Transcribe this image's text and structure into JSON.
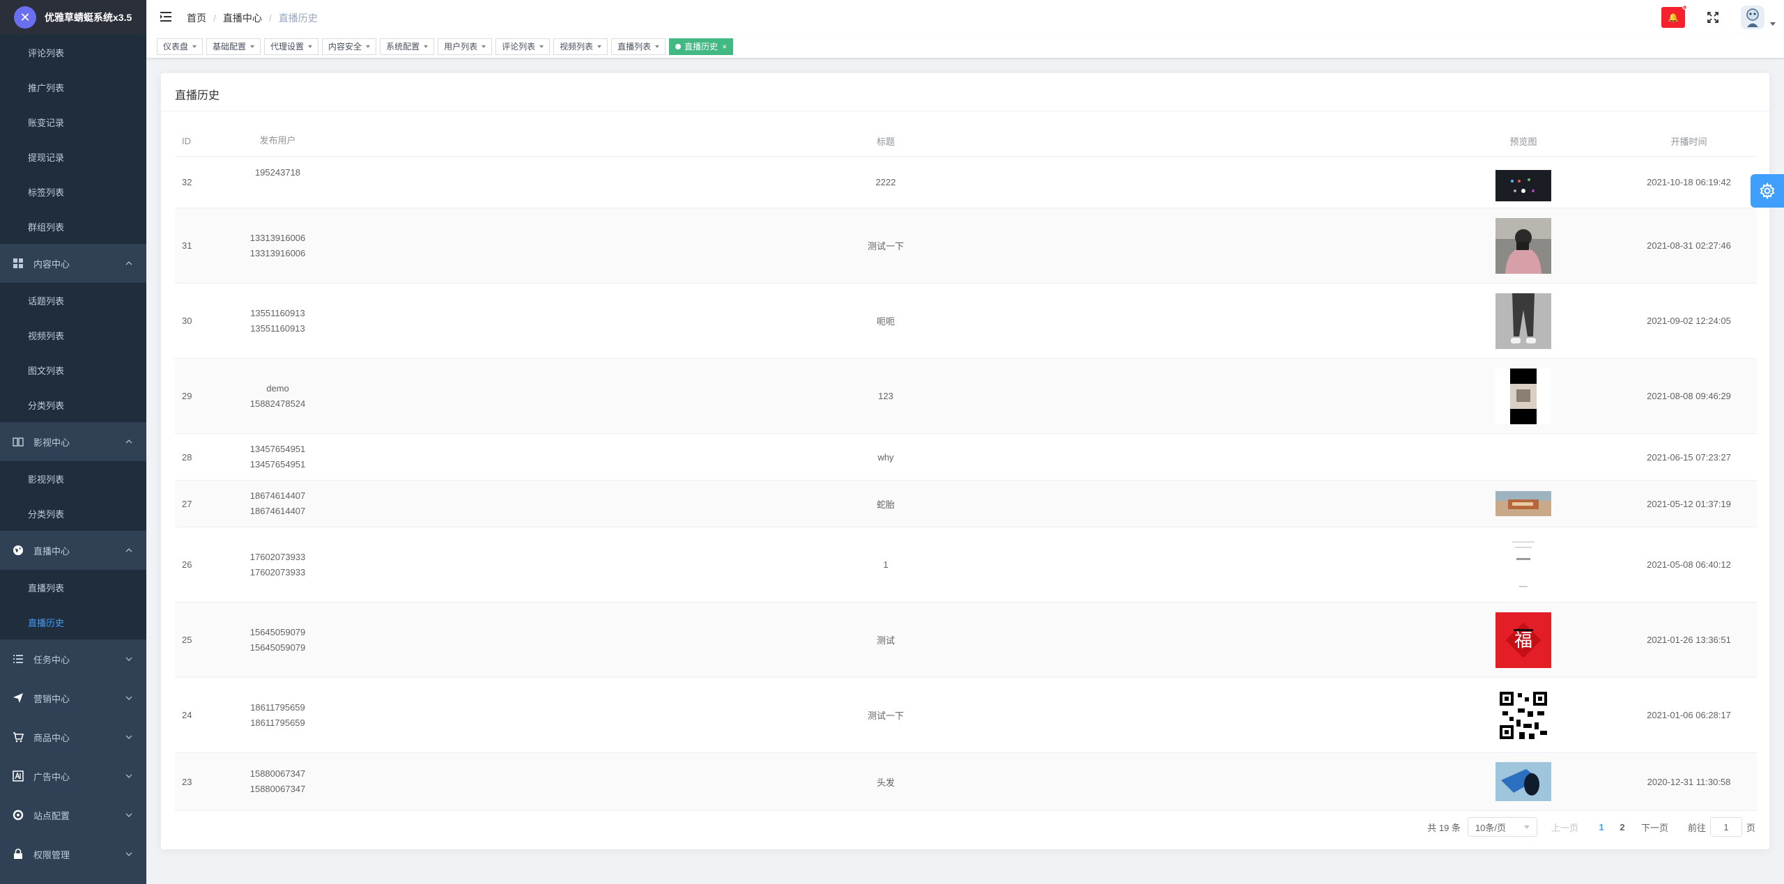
{
  "app": {
    "title": "优雅草蜻蜓系统x3.5",
    "logo_glyph": "✕"
  },
  "sidebar": {
    "items_top": [
      "评论列表",
      "推广列表",
      "账变记录",
      "提现记录",
      "标签列表",
      "群组列表"
    ],
    "groups": [
      {
        "label": "内容中心",
        "icon": "grid-icon",
        "expanded": true,
        "children": [
          "话题列表",
          "视频列表",
          "图文列表",
          "分类列表"
        ]
      },
      {
        "label": "影视中心",
        "icon": "book-icon",
        "expanded": true,
        "children": [
          "影视列表",
          "分类列表"
        ]
      },
      {
        "label": "直播中心",
        "icon": "globe-icon",
        "expanded": true,
        "children": [
          "直播列表",
          "直播历史"
        ]
      },
      {
        "label": "任务中心",
        "icon": "list-icon",
        "expanded": false,
        "children": []
      },
      {
        "label": "营销中心",
        "icon": "send-icon",
        "expanded": false,
        "children": []
      },
      {
        "label": "商品中心",
        "icon": "cart-icon",
        "expanded": false,
        "children": []
      },
      {
        "label": "广告中心",
        "icon": "ad-icon",
        "expanded": false,
        "children": []
      },
      {
        "label": "站点配置",
        "icon": "settings-icon",
        "expanded": false,
        "children": []
      },
      {
        "label": "权限管理",
        "icon": "lock-icon",
        "expanded": false,
        "children": []
      }
    ],
    "active_item": "直播历史"
  },
  "navbar": {
    "breadcrumb": [
      "首页",
      "直播中心",
      "直播历史"
    ],
    "notify_label": "🔔",
    "colors": {
      "notify": "#f5222d",
      "accent": "#409eff",
      "tag_active": "#42b983"
    }
  },
  "tags": [
    {
      "label": "仪表盘",
      "active": false
    },
    {
      "label": "基础配置",
      "active": false
    },
    {
      "label": "代理设置",
      "active": false
    },
    {
      "label": "内容安全",
      "active": false
    },
    {
      "label": "系统配置",
      "active": false
    },
    {
      "label": "用户列表",
      "active": false
    },
    {
      "label": "评论列表",
      "active": false
    },
    {
      "label": "视频列表",
      "active": false
    },
    {
      "label": "直播列表",
      "active": false
    },
    {
      "label": "直播历史",
      "active": true
    }
  ],
  "card": {
    "title": "直播历史"
  },
  "table": {
    "headers": {
      "id": "ID",
      "user": "发布用户",
      "title": "标题",
      "preview": "预览图",
      "time": "开播时间"
    },
    "rows": [
      {
        "id": "32",
        "user_lines": [
          "195243718"
        ],
        "title": "2222",
        "thumb": "dark-screen",
        "time": "2021-10-18 06:19:42"
      },
      {
        "id": "31",
        "user_lines": [
          "13313916006",
          "13313916006"
        ],
        "title": "测试一下",
        "thumb": "person-photo",
        "time": "2021-08-31 02:27:46"
      },
      {
        "id": "30",
        "user_lines": [
          "13551160913",
          "13551160913"
        ],
        "title": "呃呃",
        "thumb": "pants-photo",
        "time": "2021-09-02 12:24:05"
      },
      {
        "id": "29",
        "user_lines": [
          "demo",
          "15882478524"
        ],
        "title": "123",
        "thumb": "black-bars",
        "time": "2021-08-08 09:46:29"
      },
      {
        "id": "28",
        "user_lines": [
          "13457654951",
          "13457654951"
        ],
        "title": "why",
        "thumb": "",
        "time": "2021-06-15 07:23:27"
      },
      {
        "id": "27",
        "user_lines": [
          "18674614407",
          "18674614407"
        ],
        "title": "蛇胎",
        "thumb": "banner-photo",
        "time": "2021-05-12 01:37:19"
      },
      {
        "id": "26",
        "user_lines": [
          "17602073933",
          "17602073933"
        ],
        "title": "1",
        "thumb": "white-screen",
        "time": "2021-05-08 06:40:12"
      },
      {
        "id": "25",
        "user_lines": [
          "15645059079",
          "15645059079"
        ],
        "title": "测试",
        "thumb": "red-fu",
        "time": "2021-01-26 13:36:51"
      },
      {
        "id": "24",
        "user_lines": [
          "18611795659",
          "18611795659"
        ],
        "title": "测试一下",
        "thumb": "qr-code",
        "time": "2021-01-06 06:28:17"
      },
      {
        "id": "23",
        "user_lines": [
          "15880067347",
          "15880067347"
        ],
        "title": "头发",
        "thumb": "blue-roll",
        "time": "2020-12-31 11:30:58"
      }
    ]
  },
  "pagination": {
    "total": "共 19 条",
    "page_size": "10条/页",
    "prev": "上一页",
    "pages": [
      "1",
      "2"
    ],
    "current": "1",
    "next": "下一页",
    "jump_prefix": "前往",
    "jump_value": "1",
    "jump_suffix": "页"
  }
}
